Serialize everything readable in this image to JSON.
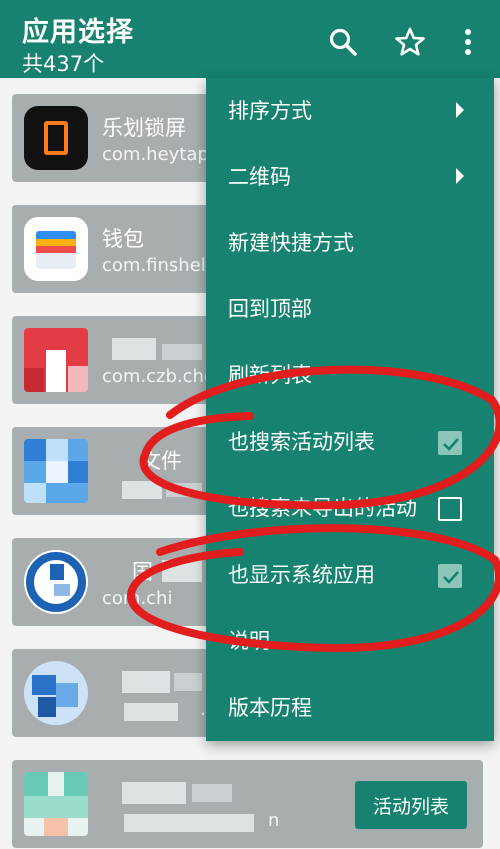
{
  "header": {
    "title": "应用选择",
    "subtitle": "共437个",
    "icons": [
      "search-icon",
      "star-icon",
      "more-vert-icon"
    ]
  },
  "list": {
    "items": [
      {
        "name": "乐划锁屏",
        "package": "com.heytap.",
        "icon": "orange-square-logo"
      },
      {
        "name": "钱包",
        "package": "com.finshell",
        "icon": "wallet-cards"
      },
      {
        "name": "",
        "package": "com.czb.che",
        "icon": "red-pixelated"
      },
      {
        "name": "文件",
        "package": "",
        "icon": "blue-pixelated"
      },
      {
        "name": "国",
        "package": "com.chi",
        "icon": "blue-e-logo"
      },
      {
        "name": "",
        "package": ".o",
        "icon": "blue-pixelated-2"
      },
      {
        "name": "",
        "package": "n",
        "icon": "cyan-pixelated"
      }
    ],
    "action_label": "活动列表"
  },
  "menu": {
    "items": [
      {
        "label": "排序方式",
        "type": "submenu"
      },
      {
        "label": "二维码",
        "type": "submenu"
      },
      {
        "label": "新建快捷方式",
        "type": "action"
      },
      {
        "label": "回到顶部",
        "type": "action"
      },
      {
        "label": "刷新列表",
        "type": "action"
      },
      {
        "label": "也搜索活动列表",
        "type": "checkbox",
        "checked": true
      },
      {
        "label": "也搜索未导出的活动",
        "type": "checkbox",
        "checked": false
      },
      {
        "label": "也显示系统应用",
        "type": "checkbox",
        "checked": true
      },
      {
        "label": "说明",
        "type": "action"
      },
      {
        "label": "版本历程",
        "type": "action"
      }
    ]
  },
  "colors": {
    "accent": "#16826f",
    "card": "#a8aeb0",
    "annotation": "#e11d1d"
  }
}
